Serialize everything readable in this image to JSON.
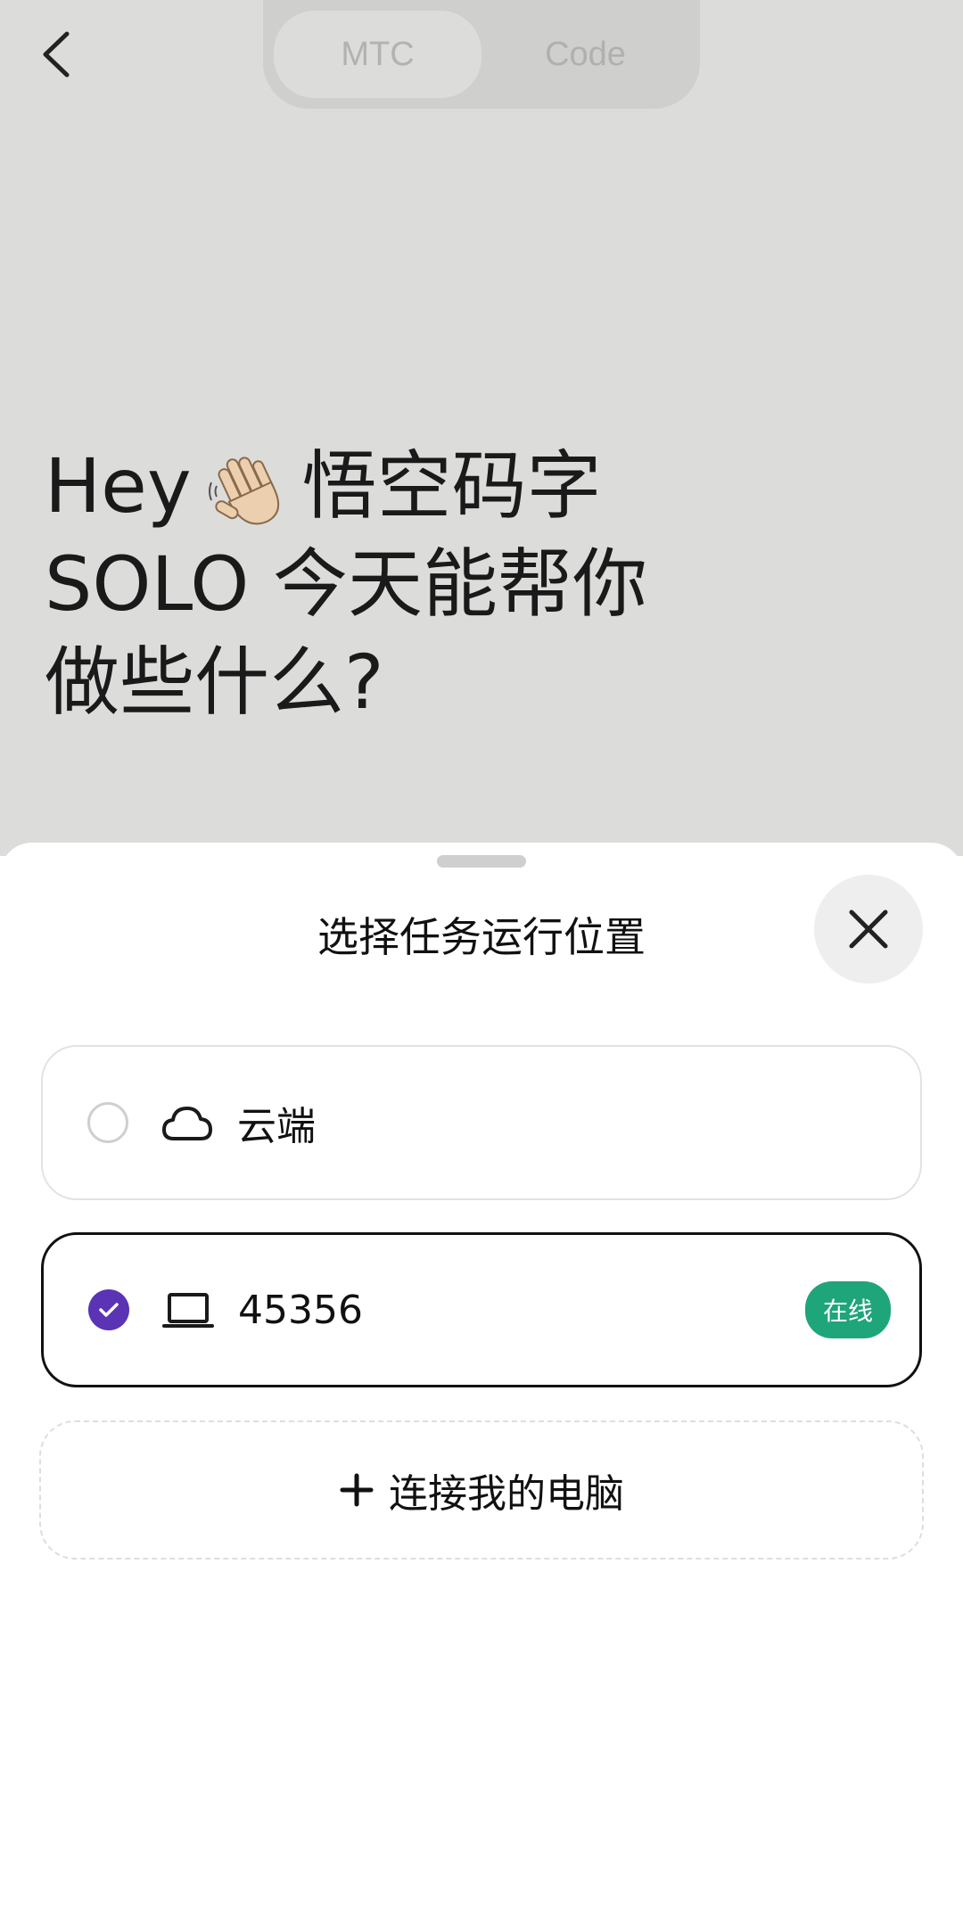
{
  "segmented": {
    "options": [
      "MTC",
      "Code"
    ],
    "active": "MTC"
  },
  "greeting": {
    "line1_pre": "Hey",
    "line1_post": "悟空码字",
    "line2": "SOLO 今天能帮你",
    "line3": "做些什么?",
    "emoji_icon": "waving-hand-icon"
  },
  "sheet": {
    "title": "选择任务运行位置",
    "options": [
      {
        "label": "云端",
        "icon": "cloud-icon",
        "selected": false
      },
      {
        "label": "45356",
        "icon": "laptop-icon",
        "selected": true,
        "badge": "在线"
      }
    ],
    "connect_label": "连接我的电脑"
  },
  "colors": {
    "accent_purple": "#5a34b5",
    "online_green": "#1fa57a",
    "backdrop": "#dcdcdb"
  }
}
